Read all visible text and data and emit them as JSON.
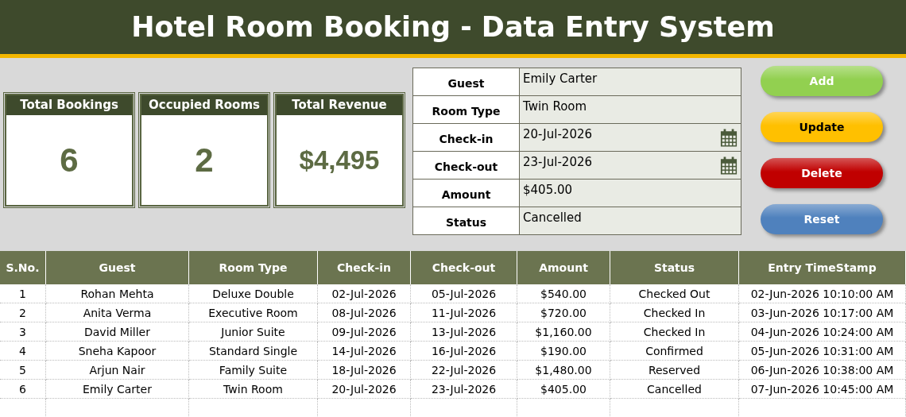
{
  "title": "Hotel Room Booking - Data Entry System",
  "kpis": [
    {
      "label": "Total Bookings",
      "value": "6"
    },
    {
      "label": "Occupied Rooms",
      "value": "2"
    },
    {
      "label": "Total Revenue",
      "value": "$4,495"
    }
  ],
  "form": [
    {
      "label": "Guest",
      "value": "Emily Carter",
      "kind": "text"
    },
    {
      "label": "Room Type",
      "value": "Twin Room",
      "kind": "text"
    },
    {
      "label": "Check-in",
      "value": "20-Jul-2026",
      "kind": "date"
    },
    {
      "label": "Check-out",
      "value": "23-Jul-2026",
      "kind": "date"
    },
    {
      "label": "Amount",
      "value": "$405.00",
      "kind": "text"
    },
    {
      "label": "Status",
      "value": "Cancelled",
      "kind": "text"
    }
  ],
  "buttons": [
    {
      "label": "Add",
      "color": "#92d050"
    },
    {
      "label": "Update",
      "color": "#ffc000"
    },
    {
      "label": "Delete",
      "color": "#c00000"
    },
    {
      "label": "Reset",
      "color": "#4f81bd"
    }
  ],
  "table": {
    "columns": [
      "S.No.",
      "Guest",
      "Room Type",
      "Check-in",
      "Check-out",
      "Amount",
      "Status",
      "Entry TimeStamp"
    ],
    "rows": [
      [
        "1",
        "Rohan Mehta",
        "Deluxe Double",
        "02-Jul-2026",
        "05-Jul-2026",
        "$540.00",
        "Checked Out",
        "02-Jun-2026 10:10:00 AM"
      ],
      [
        "2",
        "Anita Verma",
        "Executive Room",
        "08-Jul-2026",
        "11-Jul-2026",
        "$720.00",
        "Checked In",
        "03-Jun-2026 10:17:00 AM"
      ],
      [
        "3",
        "David Miller",
        "Junior Suite",
        "09-Jul-2026",
        "13-Jul-2026",
        "$1,160.00",
        "Checked In",
        "04-Jun-2026 10:24:00 AM"
      ],
      [
        "4",
        "Sneha Kapoor",
        "Standard Single",
        "14-Jul-2026",
        "16-Jul-2026",
        "$190.00",
        "Confirmed",
        "05-Jun-2026 10:31:00 AM"
      ],
      [
        "5",
        "Arjun Nair",
        "Family Suite",
        "18-Jul-2026",
        "22-Jul-2026",
        "$1,480.00",
        "Reserved",
        "06-Jun-2026 10:38:00 AM"
      ],
      [
        "6",
        "Emily Carter",
        "Twin Room",
        "20-Jul-2026",
        "23-Jul-2026",
        "$405.00",
        "Cancelled",
        "07-Jun-2026 10:45:00 AM"
      ]
    ]
  }
}
